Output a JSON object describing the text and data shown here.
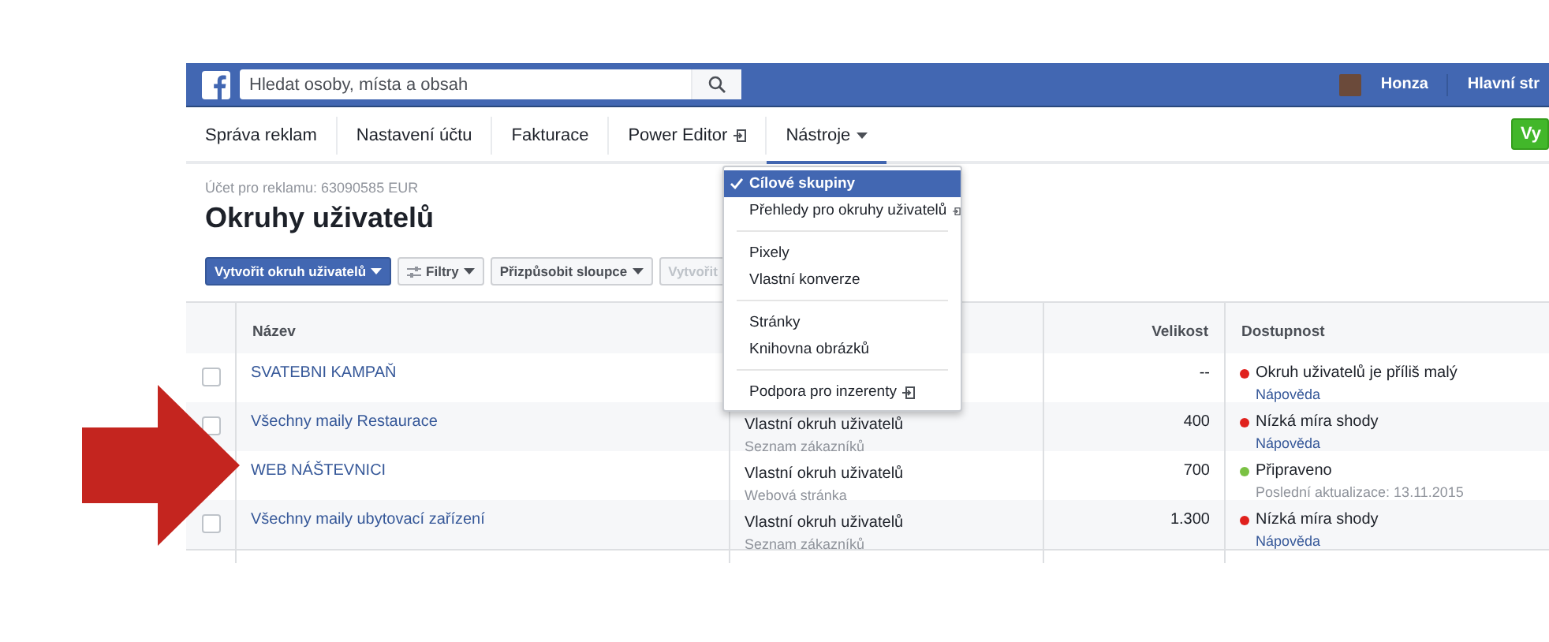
{
  "topbar": {
    "search": {
      "placeholder": "Hledat osoby, místa a obsah"
    },
    "user": "Honza",
    "home_link": "Hlavní str"
  },
  "nav": {
    "items": [
      {
        "label": "Správa reklam",
        "selected": false,
        "external": false,
        "dropdown": false
      },
      {
        "label": "Nastavení účtu",
        "selected": false,
        "external": false,
        "dropdown": false
      },
      {
        "label": "Fakturace",
        "selected": false,
        "external": false,
        "dropdown": false
      },
      {
        "label": "Power Editor",
        "selected": false,
        "external": true,
        "dropdown": false
      },
      {
        "label": "Nástroje",
        "selected": true,
        "external": false,
        "dropdown": true
      }
    ],
    "action_button": "Vy"
  },
  "header": {
    "account": "Účet pro reklamu: 63090585 EUR",
    "title": "Okruhy uživatelů"
  },
  "toolbar": [
    {
      "label": "Vytvořit okruh uživatelů",
      "kind": "primary",
      "icon": false,
      "disabled": false
    },
    {
      "label": "Filtry",
      "kind": "secondary",
      "icon": true,
      "disabled": false
    },
    {
      "label": "Přizpůsobit sloupce",
      "kind": "secondary",
      "icon": false,
      "disabled": false
    },
    {
      "label": "Vytvořit",
      "kind": "secondary",
      "icon": false,
      "disabled": true
    }
  ],
  "menu": {
    "groups": [
      [
        {
          "label": "Cílové skupiny",
          "selected": true,
          "external": false
        },
        {
          "label": "Přehledy pro okruhy uživatelů",
          "selected": false,
          "external": true
        }
      ],
      [
        {
          "label": "Pixely",
          "selected": false,
          "external": false
        },
        {
          "label": "Vlastní konverze",
          "selected": false,
          "external": false
        }
      ],
      [
        {
          "label": "Stránky",
          "selected": false,
          "external": false
        },
        {
          "label": "Knihovna obrázků",
          "selected": false,
          "external": false
        }
      ],
      [
        {
          "label": "Podpora pro inzerenty",
          "selected": false,
          "external": true
        }
      ]
    ]
  },
  "table": {
    "columns": [
      "Název",
      "Velikost",
      "Dostupnost"
    ],
    "rows": [
      {
        "checked": false,
        "name": "SVATEBNI KAMPAŇ",
        "size": "--",
        "status": "Okruh uživatelů je příliš malý",
        "color": "#e0211d",
        "help": "Nápověda"
      },
      {
        "checked": false,
        "name": "Všechny maily Restaurace",
        "type": "Vlastní okruh uživatelů",
        "subtype": "Seznam zákazníků",
        "size": "400",
        "status": "Nízká míra shody",
        "color": "#e0211d",
        "help": "Nápověda"
      },
      {
        "name": "WEB NÁŠTEVNICI",
        "type": "Vlastní okruh uživatelů",
        "subtype": "Webová stránka",
        "size": "700",
        "status": "Připraveno",
        "color": "#7ac143",
        "updated": "Poslední aktualizace: 13.11.2015"
      },
      {
        "checked": false,
        "name": "Všechny maily ubytovací zařízení",
        "type": "Vlastní okruh uživatelů",
        "subtype": "Seznam zákazníků",
        "size": "1.300",
        "status": "Nízká míra shody",
        "color": "#e0211d",
        "help": "Nápověda"
      }
    ]
  }
}
